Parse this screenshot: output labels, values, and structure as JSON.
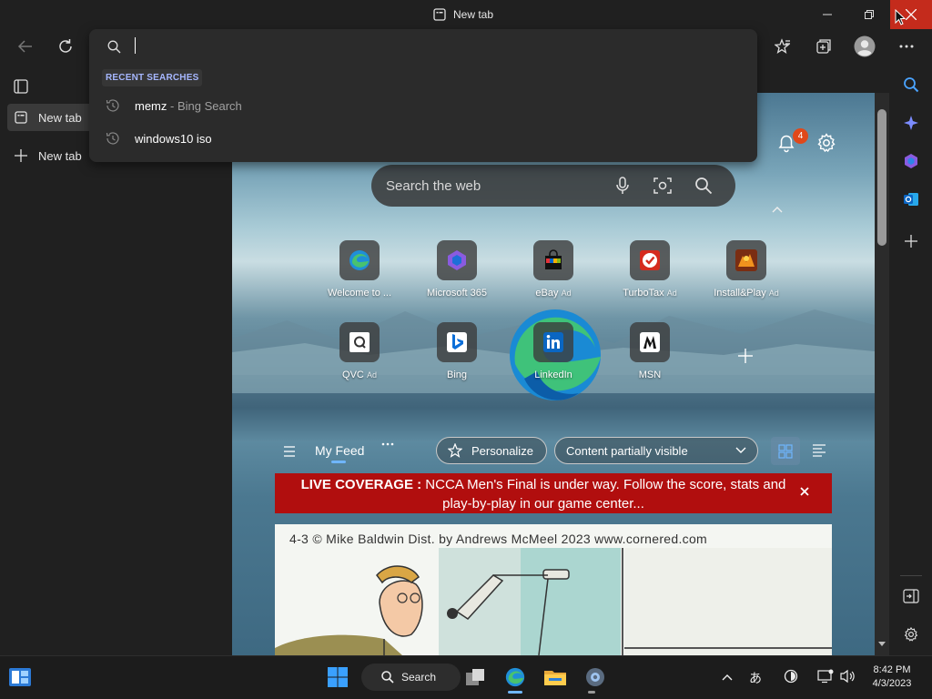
{
  "window": {
    "title": "New tab"
  },
  "tabs": [
    {
      "label": "New tab"
    }
  ],
  "new_tab_label": "New tab",
  "omnibox": {
    "value": "",
    "recent_header": "RECENT SEARCHES",
    "suggestions": [
      {
        "query": "memz",
        "sub": " - Bing Search"
      },
      {
        "query": "windows10 iso",
        "sub": ""
      }
    ]
  },
  "ntp": {
    "search_placeholder": "Search the web",
    "notification_count": "4",
    "tiles_row1": [
      {
        "label": "Welcome to ...",
        "ad": ""
      },
      {
        "label": "Microsoft 365",
        "ad": ""
      },
      {
        "label": "eBay",
        "ad": "Ad"
      },
      {
        "label": "TurboTax",
        "ad": "Ad"
      },
      {
        "label": "Install&Play",
        "ad": "Ad"
      }
    ],
    "tiles_row2": [
      {
        "label": "QVC",
        "ad": "Ad"
      },
      {
        "label": "Bing",
        "ad": ""
      },
      {
        "label": "LinkedIn",
        "ad": ""
      },
      {
        "label": "MSN",
        "ad": ""
      }
    ]
  },
  "feed": {
    "my_feed": "My Feed",
    "personalize": "Personalize",
    "content_visibility": "Content partially visible",
    "live_label": "LIVE COVERAGE :",
    "live_text": "NCCA Men's Final is under way. Follow the score, stats and play-by-play in our game center...",
    "comic_credit": "4-3  © Mike Baldwin  Dist. by Andrews McMeel 2023 www.cornered.com"
  },
  "taskbar": {
    "search_label": "Search",
    "ime": "あ",
    "time": "8:42 PM",
    "date": "4/3/2023"
  },
  "colors": {
    "accent": "#c42b1c",
    "live": "#b10e0e",
    "link_header": "#a6b7ff"
  }
}
